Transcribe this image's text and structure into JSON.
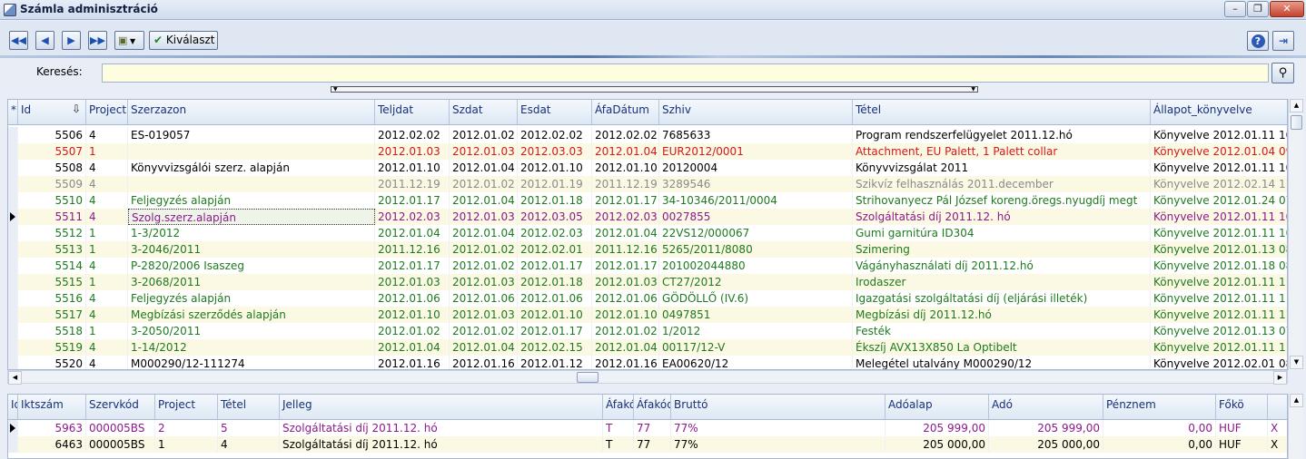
{
  "window": {
    "title": "Számla adminisztráció",
    "minimize": "–",
    "restore": "❐",
    "close": "✕"
  },
  "toolbar": {
    "select_label": "Kiválaszt"
  },
  "search": {
    "label": "Keresés:",
    "value": "",
    "placeholder": ""
  },
  "colors": {
    "black": "#000000",
    "red": "#d61818",
    "gray": "#8a8a8a",
    "green": "#1f7a1f",
    "purple": "#8b1a8b"
  },
  "main_grid": {
    "columns": [
      "*",
      "Id",
      "Project",
      "Szerzazon",
      "Teljdat",
      "Szdat",
      "Esdat",
      "ÁfaDátum",
      "Szhiv",
      "Tétel",
      "Állapot_könyvelve"
    ],
    "rows": [
      {
        "id": "5506",
        "project": "4",
        "szerzazon": "ES-019057",
        "teljdat": "2012.02.02",
        "szdat": "2012.01.02",
        "esdat": "2012.02.02",
        "afadatum": "2012.02.02",
        "szhiv": "7685633",
        "tetel": "Program rendszerfelügyelet 2011.12.hó",
        "allapot": "Könyvelve 2012.01.11 10:",
        "color": "black"
      },
      {
        "id": "5507",
        "project": "1",
        "szerzazon": "",
        "teljdat": "2012.01.03",
        "szdat": "2012.01.03",
        "esdat": "2012.03.03",
        "afadatum": "2012.01.04",
        "szhiv": "EUR2012/0001",
        "tetel": "Attachment, EU Palett, 1 Palett collar",
        "allapot": "Könyvelve 2012.01.04 09:",
        "color": "red"
      },
      {
        "id": "5508",
        "project": "4",
        "szerzazon": "Könyvvizsgálói szerz. alapján",
        "teljdat": "2012.01.10",
        "szdat": "2012.01.04",
        "esdat": "2012.01.10",
        "afadatum": "2012.01.10",
        "szhiv": "20120004",
        "tetel": "Könyvvizsgálat 2011",
        "allapot": "Könyvelve 2012.01.11 10:",
        "color": "black"
      },
      {
        "id": "5509",
        "project": "4",
        "szerzazon": "",
        "teljdat": "2011.12.19",
        "szdat": "2012.01.02",
        "esdat": "2012.01.19",
        "afadatum": "2011.12.19",
        "szhiv": "3289546",
        "tetel": "Szikvíz felhasználás 2011.december",
        "allapot": "Könyvelve 2012.02.14 11:",
        "color": "gray"
      },
      {
        "id": "5510",
        "project": "4",
        "szerzazon": "Feljegyzés alapján",
        "teljdat": "2012.01.17",
        "szdat": "2012.01.04",
        "esdat": "2012.01.18",
        "afadatum": "2012.01.17",
        "szhiv": "34-10346/2011/0004",
        "tetel": "Strihovanyecz Pál József koreng.öregs.nyugdíj megt",
        "allapot": "Könyvelve 2012.01.24 07:",
        "color": "green"
      },
      {
        "id": "5511",
        "project": "4",
        "szerzazon": "Szolg.szerz.alapján",
        "teljdat": "2012.02.03",
        "szdat": "2012.01.03",
        "esdat": "2012.03.05",
        "afadatum": "2012.02.03",
        "szhiv": "0027855",
        "tetel": "Szolgáltatási díj 2011.12. hó",
        "allapot": "Könyvelve 2012.01.11 10:",
        "color": "purple",
        "current": true
      },
      {
        "id": "5512",
        "project": "1",
        "szerzazon": "1-3/2012",
        "teljdat": "2012.01.04",
        "szdat": "2012.01.04",
        "esdat": "2012.02.03",
        "afadatum": "2012.01.04",
        "szhiv": "22VS12/000067",
        "tetel": "Gumi garnitúra ID304",
        "allapot": "Könyvelve 2012.01.11 10:",
        "color": "green"
      },
      {
        "id": "5513",
        "project": "1",
        "szerzazon": "3-2046/2011",
        "teljdat": "2011.12.16",
        "szdat": "2012.01.02",
        "esdat": "2012.02.01",
        "afadatum": "2011.12.16",
        "szhiv": "5265/2011/8080",
        "tetel": "Szimering",
        "allapot": "Könyvelve 2012.01.13 08:",
        "color": "green"
      },
      {
        "id": "5514",
        "project": "4",
        "szerzazon": "P-2820/2006 Isaszeg",
        "teljdat": "2012.01.17",
        "szdat": "2012.01.02",
        "esdat": "2012.01.17",
        "afadatum": "2012.01.17",
        "szhiv": "201002044880",
        "tetel": "Vágányhasználati díj 2011.12.hó",
        "allapot": "Könyvelve 2012.01.18 08:",
        "color": "green"
      },
      {
        "id": "5515",
        "project": "1",
        "szerzazon": "3-2068/2011",
        "teljdat": "2012.01.03",
        "szdat": "2012.01.03",
        "esdat": "2012.01.18",
        "afadatum": "2012.01.03",
        "szhiv": "CT27/2012",
        "tetel": "Irodaszer",
        "allapot": "Könyvelve 2012.01.11 11:",
        "color": "green"
      },
      {
        "id": "5516",
        "project": "4",
        "szerzazon": "Feljegyzés alapján",
        "teljdat": "2012.01.06",
        "szdat": "2012.01.06",
        "esdat": "2012.01.06",
        "afadatum": "2012.01.06",
        "szhiv": "GÖDÖLLŐ (IV.6)",
        "tetel": "Igazgatási szolgáltatási díj (eljárási illeték)",
        "allapot": "Könyvelve 2012.01.11 11:",
        "color": "green"
      },
      {
        "id": "5517",
        "project": "4",
        "szerzazon": "Megbízási szerződés alapján",
        "teljdat": "2012.01.10",
        "szdat": "2012.01.03",
        "esdat": "2012.01.10",
        "afadatum": "2012.01.10",
        "szhiv": "0497851",
        "tetel": "Megbízási díj 2011.12.hó",
        "allapot": "Könyvelve 2012.01.11 11:",
        "color": "green"
      },
      {
        "id": "5518",
        "project": "1",
        "szerzazon": "3-2050/2011",
        "teljdat": "2012.01.02",
        "szdat": "2012.01.02",
        "esdat": "2012.01.17",
        "afadatum": "2012.01.02",
        "szhiv": "1/2012",
        "tetel": "Festék",
        "allapot": "Könyvelve 2012.01.13 07:",
        "color": "green"
      },
      {
        "id": "5519",
        "project": "4",
        "szerzazon": "1-14/2012",
        "teljdat": "2012.01.04",
        "szdat": "2012.01.04",
        "esdat": "2012.02.15",
        "afadatum": "2012.01.04",
        "szhiv": "00117/12-V",
        "tetel": "Ékszíj AVX13X850 La Optibelt",
        "allapot": "Könyvelve 2012.01.11 11:",
        "color": "green"
      },
      {
        "id": "5520",
        "project": "4",
        "szerzazon": "M000290/12-111274",
        "teljdat": "2012.01.16",
        "szdat": "2012.01.16",
        "esdat": "2012.01.12",
        "afadatum": "2012.01.16",
        "szhiv": "EA00620/12",
        "tetel": "Melegétel utalvány M000290/12",
        "allapot": "Könyvelve 2012.02.01 08:",
        "color": "black"
      }
    ]
  },
  "detail_grid": {
    "columns": [
      "Id",
      "Iktszám",
      "Szervkód",
      "Project",
      "Tétel",
      "Jelleg",
      "Áfakód",
      "Áfakód megnevezés",
      "Bruttó",
      "Adóalap",
      "Adó",
      "Pénznem",
      "Főkö"
    ],
    "rows": [
      {
        "id": "5963",
        "iktszam": "000005BS",
        "szervkod": "2",
        "project": "5",
        "tetel": "Szolgáltatási díj 2011.12. hó",
        "jelleg": "T",
        "afakod": "77",
        "afakod_megnev": "77%",
        "brutto": "205 999,00",
        "adoalap": "205 999,00",
        "ado": "0,00",
        "penznem": "HUF",
        "foko": "X",
        "color": "purple",
        "current": true
      },
      {
        "id": "6463",
        "iktszam": "000005BS",
        "szervkod": "1",
        "project": "4",
        "tetel": "Szolgáltatási díj 2011.12. hó",
        "jelleg": "T",
        "afakod": "77",
        "afakod_megnev": "77%",
        "brutto": "205 000,00",
        "adoalap": "205 000,00",
        "ado": "0,00",
        "penznem": "HUF",
        "foko": "X",
        "color": "black"
      }
    ]
  }
}
